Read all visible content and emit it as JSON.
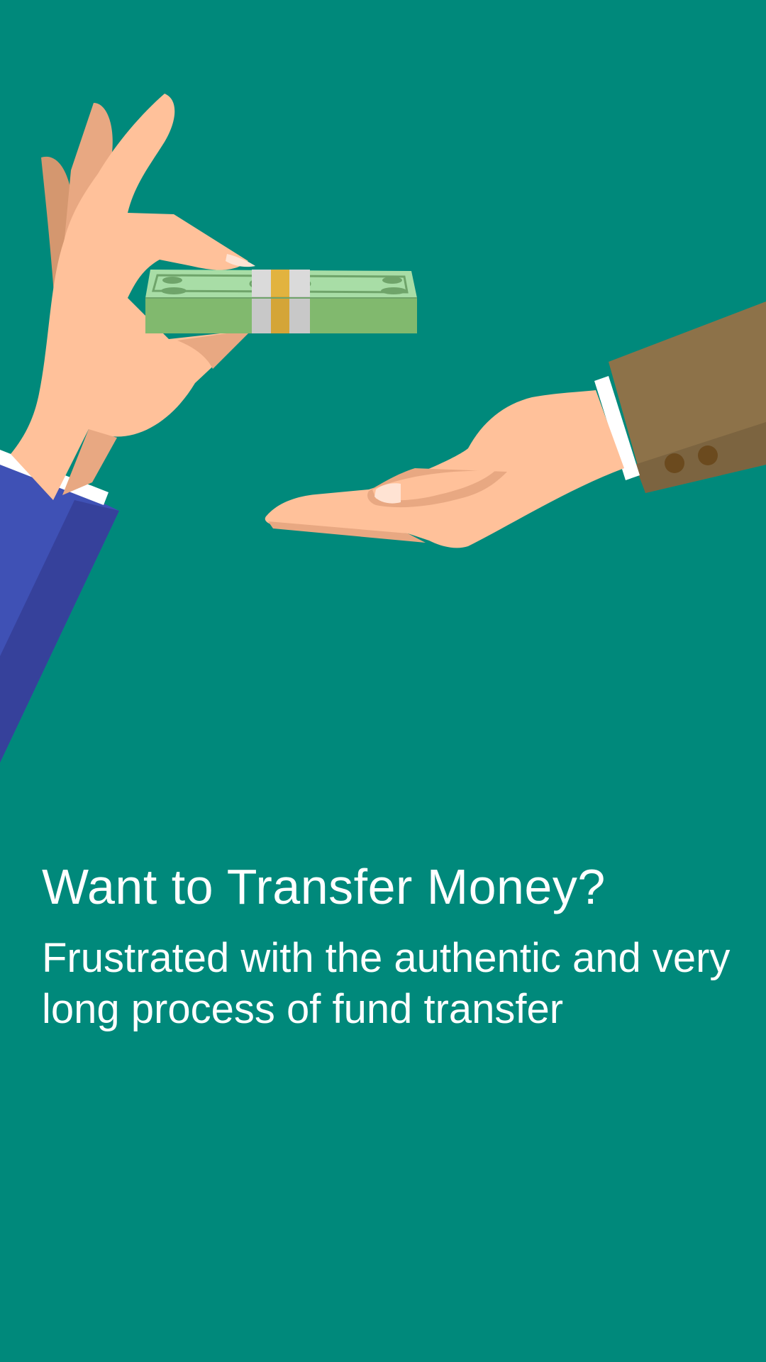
{
  "screen": {
    "background_color": "#00897B",
    "illustration": {
      "description_icon": "hand-giving-money-icon",
      "colors": {
        "skin": "#FFC19A",
        "skin_shadow": "#E8A882",
        "left_sleeve": "#3F51B5",
        "right_sleeve": "#8D6E4A",
        "cash": "#81B96E",
        "band": "#D4A537"
      }
    },
    "title": "Want to Transfer Money?",
    "subtitle": "Frustrated with the authentic and very long process of fund transfer"
  }
}
